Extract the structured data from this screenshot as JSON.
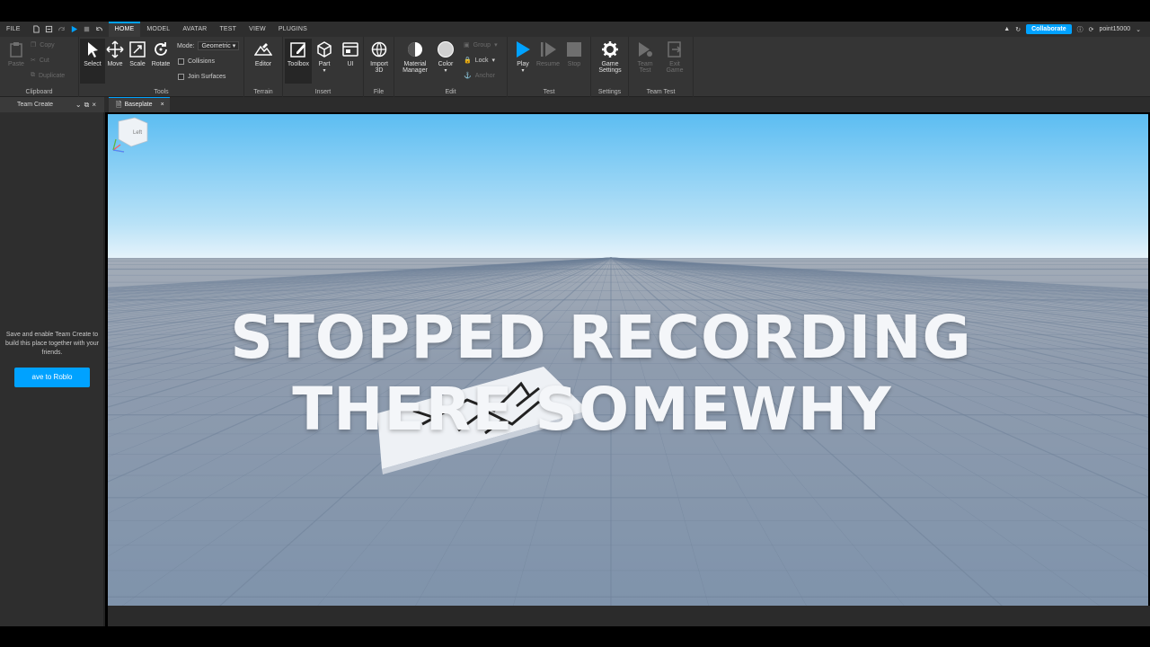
{
  "menu": {
    "file": "FILE",
    "tabs": [
      "HOME",
      "MODEL",
      "AVATAR",
      "TEST",
      "VIEW",
      "PLUGINS"
    ],
    "active_tab": "HOME",
    "collaborate": "Collaborate",
    "username": "point15000"
  },
  "ribbon": {
    "clipboard": {
      "paste": "Paste",
      "copy": "Copy",
      "cut": "Cut",
      "duplicate": "Duplicate",
      "label": "Clipboard"
    },
    "tools": {
      "select": "Select",
      "move": "Move",
      "scale": "Scale",
      "rotate": "Rotate",
      "mode_label": "Mode:",
      "mode_value": "Geometric",
      "collisions": "Collisions",
      "join_surfaces": "Join Surfaces",
      "label": "Tools"
    },
    "terrain": {
      "editor": "Editor",
      "label": "Terrain"
    },
    "insert": {
      "toolbox": "Toolbox",
      "part": "Part",
      "ui": "UI",
      "label": "Insert"
    },
    "file": {
      "import3d_line1": "Import",
      "import3d_line2": "3D",
      "label": "File"
    },
    "edit": {
      "material_line1": "Material",
      "material_line2": "Manager",
      "color": "Color",
      "group": "Group",
      "lock": "Lock",
      "anchor": "Anchor",
      "label": "Edit"
    },
    "test": {
      "play": "Play",
      "resume": "Resume",
      "stop": "Stop",
      "label": "Test"
    },
    "settings": {
      "game_line1": "Game",
      "game_line2": "Settings",
      "label": "Settings"
    },
    "team_test": {
      "team_line1": "Team",
      "team_line2": "Test",
      "exit_line1": "Exit",
      "exit_line2": "Game",
      "label": "Team Test"
    }
  },
  "panels": {
    "team_create_tab": "Team Create",
    "document_tab": "Baseplate",
    "team_create_message": "Save and enable Team Create to build this place together with your friends.",
    "save_button": "ave to Roblo"
  },
  "viewport": {
    "overlay_line1": "STOPPED RECORDING",
    "overlay_line2": "THERE SOMEWHY",
    "view_cube_label": "Left"
  },
  "colors": {
    "accent": "#00a2ff",
    "sky_top": "#5cbdf2",
    "sky_horizon": "#e9f4fb",
    "baseplate": "#8c9cb1"
  }
}
